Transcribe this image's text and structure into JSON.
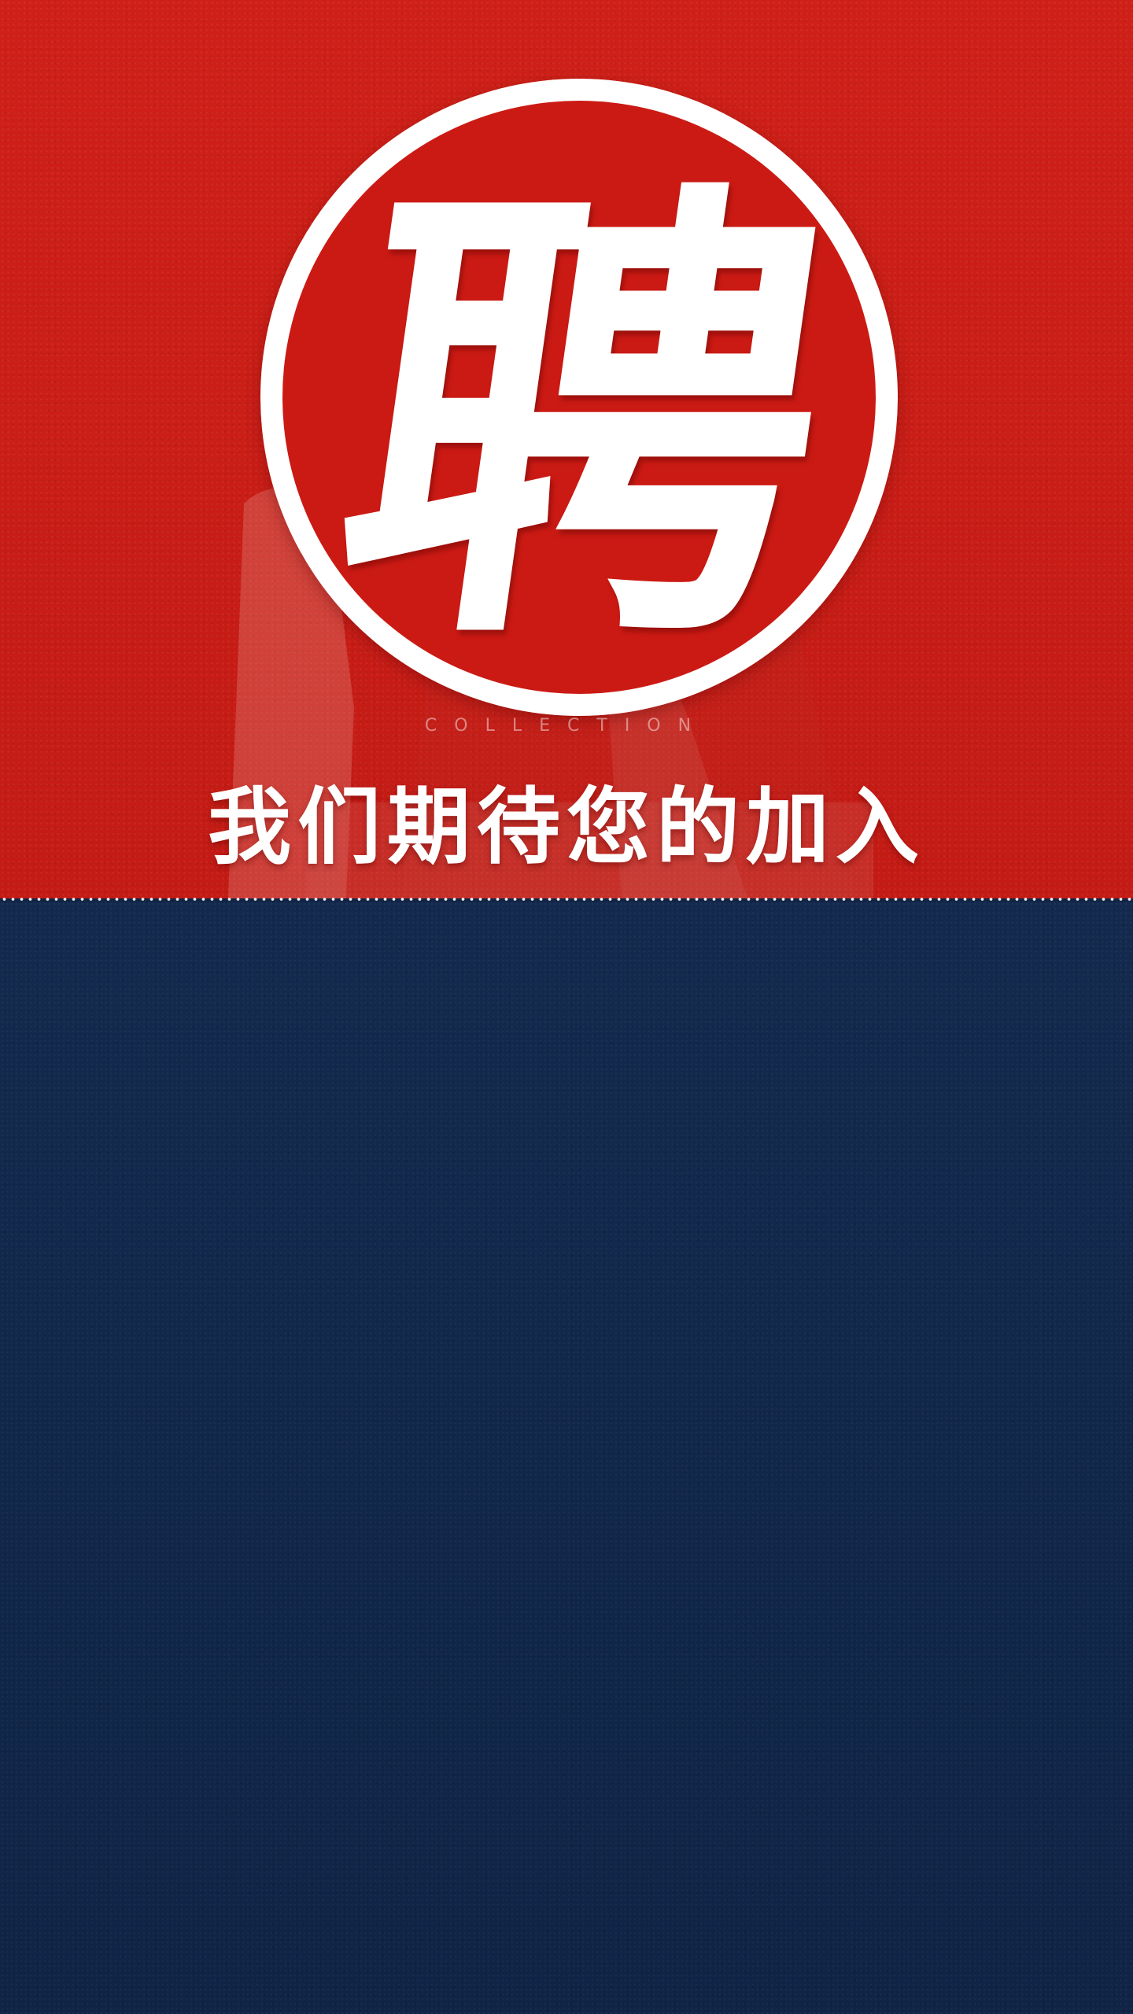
{
  "colors": {
    "top_red": "#c81c16",
    "seal_red": "#cb1a14",
    "seal_white": "#ffffff",
    "bottom_navy": "#11284b",
    "headline": "#ffffff"
  },
  "seal": {
    "character": "聘"
  },
  "tagline": "COLLECTION",
  "headline": "我们期待您的加入"
}
